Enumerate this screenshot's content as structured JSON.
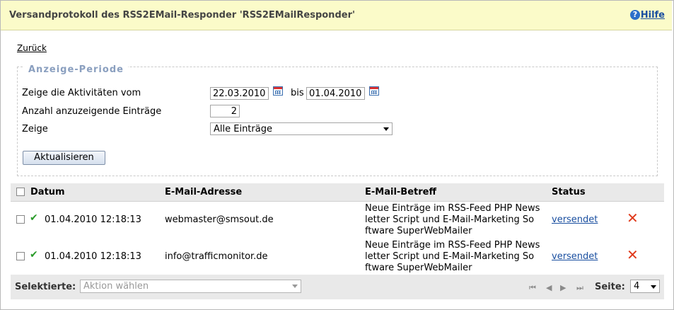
{
  "header": {
    "title": "Versandprotokoll des RSS2EMail-Responder 'RSS2EMailResponder'",
    "help_label": "Hilfe",
    "help_icon_glyph": "?"
  },
  "back_link": "Zurück",
  "period": {
    "legend": "Anzeige-Periode",
    "from_label": "Zeige die Aktivitäten vom",
    "from_value": "22.03.2010",
    "to_label": "bis",
    "to_value": "01.04.2010",
    "count_label": "Anzahl anzuzeigende Einträge",
    "count_value": "2",
    "show_label": "Zeige",
    "show_value": "Alle Einträge",
    "refresh_button": "Aktualisieren"
  },
  "table": {
    "columns": [
      "Datum",
      "E-Mail-Adresse",
      "E-Mail-Betreff",
      "Status"
    ],
    "rows": [
      {
        "date": "01.04.2010 12:18:13",
        "email": "webmaster@smsout.de",
        "subject_lines": [
          "Neue Einträge im RSS-Feed PHP News",
          "letter Script und E-Mail-Marketing So",
          "ftware SuperWebMailer"
        ],
        "status": "versendet"
      },
      {
        "date": "01.04.2010 12:18:13",
        "email": "info@trafficmonitor.de",
        "subject_lines": [
          "Neue Einträge im RSS-Feed PHP News",
          "letter Script und E-Mail-Marketing So",
          "ftware SuperWebMailer"
        ],
        "status": "versendet"
      }
    ]
  },
  "footer": {
    "selected_label": "Selektierte:",
    "action_placeholder": "Aktion wählen",
    "page_label": "Seite:",
    "page_value": "4"
  },
  "colors": {
    "header_bg": "#fbfbc9",
    "link": "#1a4fa0",
    "check": "#2a9b2a",
    "delete": "#e03b1c",
    "table_head_bg": "#e9e9e9"
  }
}
